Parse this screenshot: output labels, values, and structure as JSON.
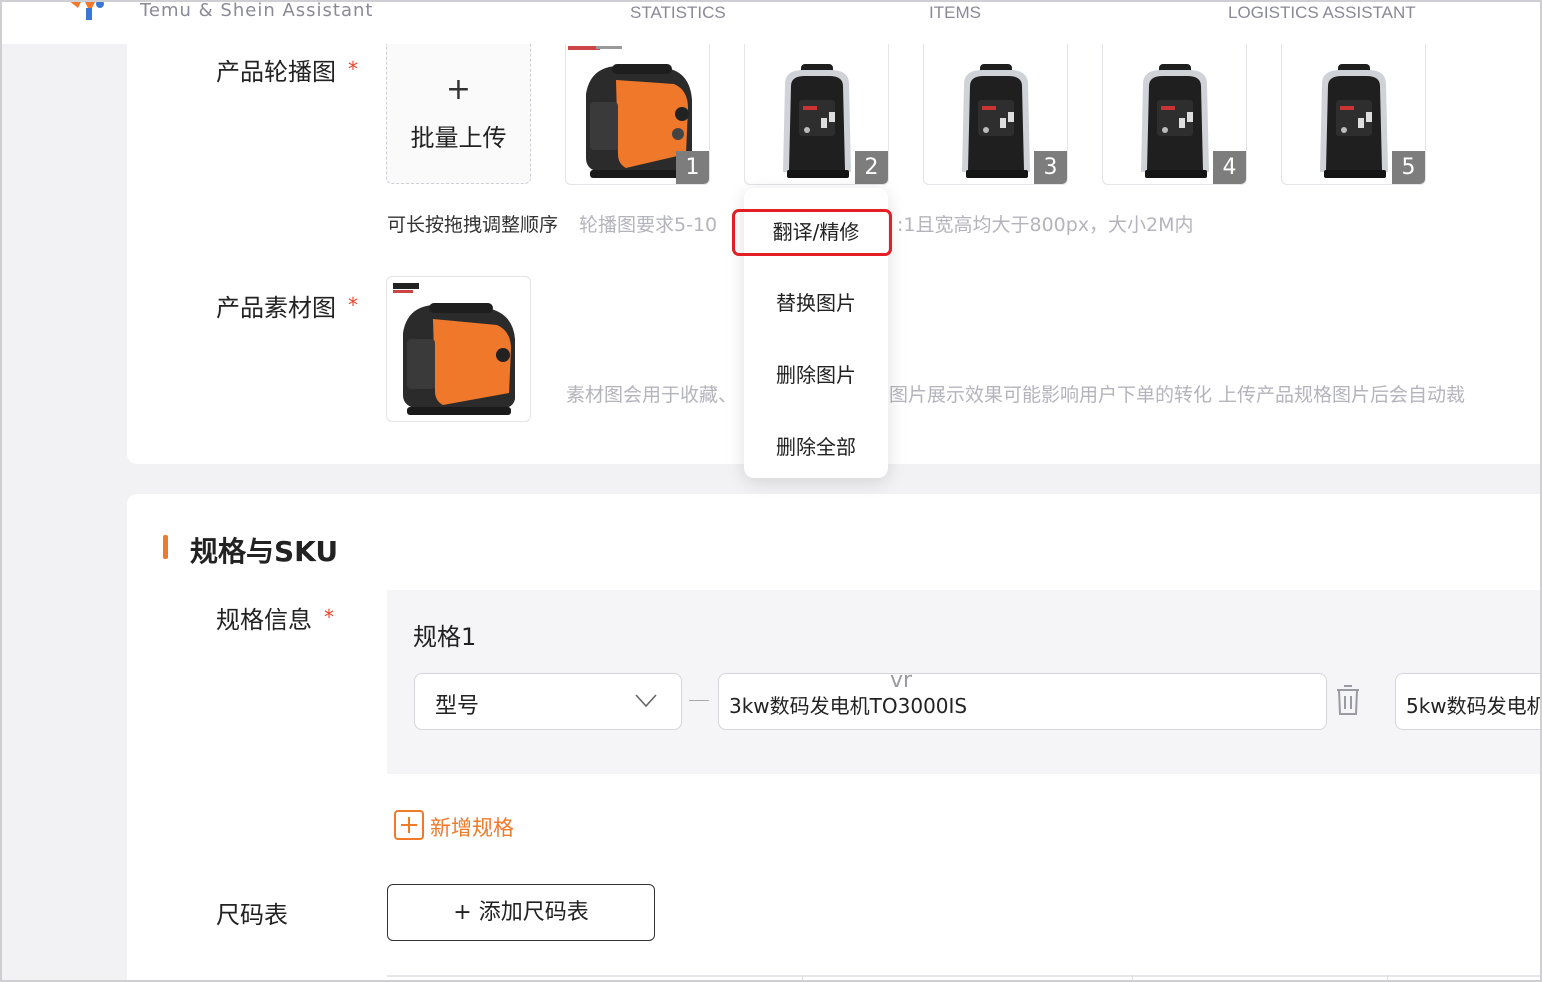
{
  "nav": {
    "brand": "Temu & Shein Assistant",
    "links": [
      "STATISTICS",
      "ITEMS",
      "LOGISTICS ASSISTANT"
    ]
  },
  "carousel": {
    "label": "产品轮播图",
    "required_mark": "*",
    "upload_plus": "+",
    "upload_label": "批量上传",
    "badges": [
      "1",
      "2",
      "3",
      "4",
      "5"
    ],
    "hint_drag": "可长按拖拽调整顺序",
    "hint_req_left": "轮播图要求5-10",
    "hint_req_right": ":1且宽高均大于800px，大小2M内"
  },
  "material": {
    "label": "产品素材图",
    "required_mark": "*",
    "hint_left": "素材图会用于收藏、",
    "hint_right": "图片展示效果可能影响用户下单的转化 上传产品规格图片后会自动裁"
  },
  "context_menu": {
    "items": [
      "翻译/精修",
      "替换图片",
      "删除图片",
      "删除全部"
    ]
  },
  "sku": {
    "section_title": "规格与SKU",
    "spec_info_label": "规格信息",
    "required_mark": "*",
    "spec_name": "规格1",
    "spec_type": "型号",
    "value1": "3kw数码发电机TO3000IS",
    "value2": "5kw数码发电机",
    "ime_hint": "vr",
    "add_spec": "新增规格",
    "size_chart_label": "尺码表",
    "add_size_chart": "+  添加尺码表"
  },
  "colors": {
    "accent": "#f07a2a",
    "required": "#e8432d",
    "highlight": "#e31e24"
  }
}
